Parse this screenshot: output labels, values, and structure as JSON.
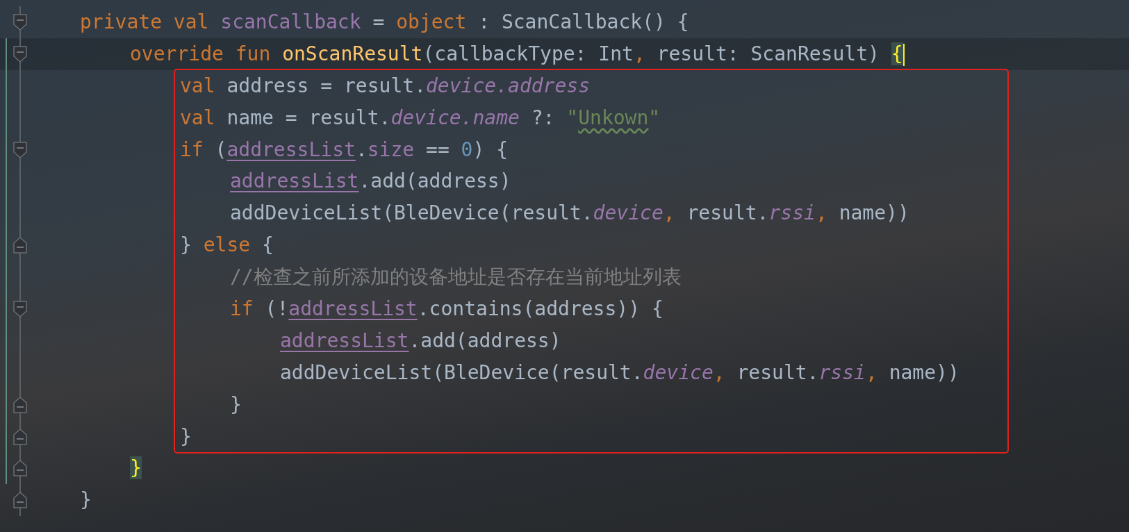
{
  "editor": {
    "lines": [
      {
        "kind": "block-start",
        "modified": false,
        "current": false,
        "boxed": false,
        "tokens": [
          {
            "kind": "keyword",
            "text": "private val "
          },
          {
            "kind": "member",
            "text": "scanCallback"
          },
          {
            "kind": "plain",
            "text": " = "
          },
          {
            "kind": "keyword",
            "text": "object"
          },
          {
            "kind": "plain",
            "text": " : ScanCallback() {"
          }
        ],
        "children": [
          {
            "kind": "block-start",
            "modified": true,
            "current": true,
            "boxed": false,
            "tokens": [
              {
                "kind": "keyword",
                "text": "override fun "
              },
              {
                "kind": "function",
                "text": "onScanResult"
              },
              {
                "kind": "plain",
                "text": "(callbackType: Int"
              },
              {
                "kind": "keyword",
                "text": ", "
              },
              {
                "kind": "plain",
                "text": "result: ScanResult) "
              },
              {
                "kind": "brace-match",
                "text": "{"
              }
            ],
            "children": [
              {
                "kind": "statement",
                "modified": true,
                "current": false,
                "boxed": true,
                "tokens": [
                  {
                    "kind": "keyword",
                    "text": "val "
                  },
                  {
                    "kind": "plain",
                    "text": "address = result."
                  },
                  {
                    "kind": "field",
                    "text": "device.address"
                  }
                ]
              },
              {
                "kind": "statement",
                "modified": true,
                "current": false,
                "boxed": true,
                "tokens": [
                  {
                    "kind": "keyword",
                    "text": "val "
                  },
                  {
                    "kind": "plain",
                    "text": "name = result."
                  },
                  {
                    "kind": "field",
                    "text": "device.name"
                  },
                  {
                    "kind": "plain",
                    "text": " ?: "
                  },
                  {
                    "kind": "string",
                    "text": "\""
                  },
                  {
                    "kind": "typo",
                    "text": "Unkown"
                  },
                  {
                    "kind": "string",
                    "text": "\""
                  }
                ]
              },
              {
                "kind": "block-start",
                "modified": true,
                "current": false,
                "boxed": true,
                "tokens": [
                  {
                    "kind": "keyword",
                    "text": "if "
                  },
                  {
                    "kind": "plain",
                    "text": "("
                  },
                  {
                    "kind": "reference",
                    "text": "addressList"
                  },
                  {
                    "kind": "plain",
                    "text": "."
                  },
                  {
                    "kind": "member",
                    "text": "size"
                  },
                  {
                    "kind": "plain",
                    "text": " == "
                  },
                  {
                    "kind": "number",
                    "text": "0"
                  },
                  {
                    "kind": "plain",
                    "text": ") {"
                  }
                ],
                "children": [
                  {
                    "kind": "statement",
                    "modified": true,
                    "current": false,
                    "boxed": true,
                    "tokens": [
                      {
                        "kind": "reference",
                        "text": "addressList"
                      },
                      {
                        "kind": "plain",
                        "text": ".add(address)"
                      }
                    ]
                  },
                  {
                    "kind": "statement",
                    "modified": true,
                    "current": false,
                    "boxed": true,
                    "tokens": [
                      {
                        "kind": "plain",
                        "text": "addDeviceList(BleDevice(result."
                      },
                      {
                        "kind": "field",
                        "text": "device"
                      },
                      {
                        "kind": "keyword",
                        "text": ", "
                      },
                      {
                        "kind": "plain",
                        "text": "result."
                      },
                      {
                        "kind": "field",
                        "text": "rssi"
                      },
                      {
                        "kind": "keyword",
                        "text": ", "
                      },
                      {
                        "kind": "plain",
                        "text": "name))"
                      }
                    ]
                  }
                ]
              },
              {
                "kind": "block-end",
                "modified": true,
                "current": false,
                "boxed": true,
                "tokens": [
                  {
                    "kind": "plain",
                    "text": "} "
                  },
                  {
                    "kind": "keyword",
                    "text": "else"
                  },
                  {
                    "kind": "plain",
                    "text": " {"
                  }
                ],
                "children": [
                  {
                    "kind": "statement",
                    "modified": true,
                    "current": false,
                    "boxed": true,
                    "tokens": [
                      {
                        "kind": "comment",
                        "text": "//检查之前所添加的设备地址是否存在当前地址列表"
                      }
                    ]
                  },
                  {
                    "kind": "block-start",
                    "modified": true,
                    "current": false,
                    "boxed": true,
                    "tokens": [
                      {
                        "kind": "keyword",
                        "text": "if "
                      },
                      {
                        "kind": "plain",
                        "text": "(!"
                      },
                      {
                        "kind": "reference",
                        "text": "addressList"
                      },
                      {
                        "kind": "plain",
                        "text": ".contains(address)) {"
                      }
                    ],
                    "children": [
                      {
                        "kind": "statement",
                        "modified": true,
                        "current": false,
                        "boxed": true,
                        "tokens": [
                          {
                            "kind": "reference",
                            "text": "addressList"
                          },
                          {
                            "kind": "plain",
                            "text": ".add(address)"
                          }
                        ]
                      },
                      {
                        "kind": "statement",
                        "modified": true,
                        "current": false,
                        "boxed": true,
                        "tokens": [
                          {
                            "kind": "plain",
                            "text": "addDeviceList(BleDevice(result."
                          },
                          {
                            "kind": "field",
                            "text": "device"
                          },
                          {
                            "kind": "keyword",
                            "text": ", "
                          },
                          {
                            "kind": "plain",
                            "text": "result."
                          },
                          {
                            "kind": "field",
                            "text": "rssi"
                          },
                          {
                            "kind": "keyword",
                            "text": ", "
                          },
                          {
                            "kind": "plain",
                            "text": "name))"
                          }
                        ]
                      }
                    ]
                  },
                  {
                    "kind": "block-end",
                    "modified": true,
                    "current": false,
                    "boxed": true,
                    "tokens": [
                      {
                        "kind": "plain",
                        "text": "}"
                      }
                    ]
                  }
                ]
              },
              {
                "kind": "block-end",
                "modified": true,
                "current": false,
                "boxed": true,
                "tokens": [
                  {
                    "kind": "plain",
                    "text": "}"
                  }
                ]
              }
            ]
          },
          {
            "kind": "block-end",
            "modified": true,
            "current": false,
            "boxed": false,
            "tokens": [
              {
                "kind": "brace-match",
                "text": "}"
              }
            ]
          }
        ]
      },
      {
        "kind": "block-end",
        "modified": false,
        "current": false,
        "boxed": false,
        "tokens": [
          {
            "kind": "plain",
            "text": "}"
          }
        ]
      }
    ]
  }
}
